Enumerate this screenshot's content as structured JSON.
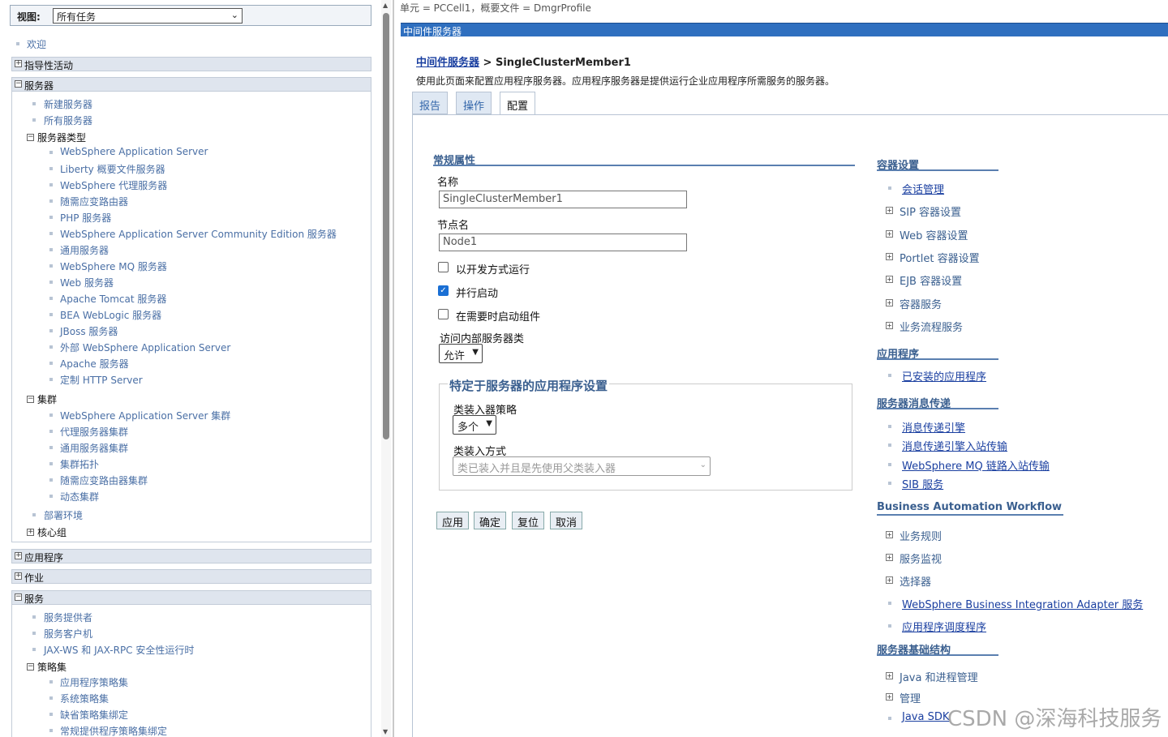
{
  "nav": {
    "view_label": "视图:",
    "view_value": "所有任务",
    "welcome": "欢迎",
    "sections": {
      "guided": "指导性活动",
      "servers": "服务器",
      "applications": "应用程序",
      "jobs": "作业",
      "services": "服务"
    },
    "servers_items": {
      "new_server": "新建服务器",
      "all_servers": "所有服务器",
      "server_types": "服务器类型",
      "types": [
        "WebSphere Application Server",
        "Liberty 概要文件服务器",
        "WebSphere 代理服务器",
        "随需应变路由器",
        "PHP 服务器",
        "WebSphere Application Server Community Edition 服务器",
        "通用服务器",
        "WebSphere MQ 服务器",
        "Web 服务器",
        "Apache Tomcat 服务器",
        "BEA WebLogic 服务器",
        "JBoss 服务器",
        "外部 WebSphere Application Server",
        "Apache 服务器",
        "定制 HTTP Server"
      ],
      "clusters": "集群",
      "cluster_items": [
        "WebSphere Application Server 集群",
        "代理服务器集群",
        "通用服务器集群",
        "集群拓扑",
        "随需应变路由器集群",
        "动态集群"
      ],
      "deployment_env": "部署环境",
      "core_groups": "核心组"
    },
    "services_items": {
      "items": [
        "服务提供者",
        "服务客户机",
        "JAX-WS 和 JAX-RPC 安全性运行时"
      ],
      "policy_sets": "策略集",
      "policy_items": [
        "应用程序策略集",
        "系统策略集",
        "缺省策略集绑定",
        "常规提供程序策略集绑定"
      ]
    }
  },
  "header": {
    "context": "单元 = PCCell1，概要文件 = DmgrProfile",
    "title": "中间件服务器"
  },
  "page": {
    "crumb_link": "中间件服务器",
    "crumb_sep": " > ",
    "crumb_current": "SingleClusterMember1",
    "description": "使用此页面来配置应用程序服务器。应用程序服务器是提供运行企业应用程序所需服务的服务器。",
    "tabs": [
      "报告",
      "操作",
      "配置"
    ]
  },
  "form": {
    "general_heading": "常规属性",
    "name_label": "名称",
    "name_value": "SingleClusterMember1",
    "node_label": "节点名",
    "node_value": "Node1",
    "dev_mode_label": "以开发方式运行",
    "dev_mode_checked": false,
    "parallel_start_label": "并行启动",
    "parallel_start_checked": true,
    "on_demand_label": "在需要时启动组件",
    "on_demand_checked": false,
    "internal_class_label": "访问内部服务器类",
    "internal_class_value": "允许",
    "app_settings_heading": "特定于服务器的应用程序设置",
    "classloader_policy_label": "类装入器策略",
    "classloader_policy_value": "多个",
    "class_loading_mode_label": "类装入方式",
    "class_loading_mode_value": "类已装入并且是先使用父类装入器",
    "buttons": [
      "应用",
      "确定",
      "复位",
      "取消"
    ]
  },
  "right": {
    "container_settings": "容器设置",
    "container_items": [
      {
        "label": "会话管理",
        "link": true
      },
      {
        "label": "SIP 容器设置",
        "link": false
      },
      {
        "label": "Web 容器设置",
        "link": false
      },
      {
        "label": "Portlet 容器设置",
        "link": false
      },
      {
        "label": "EJB 容器设置",
        "link": false
      },
      {
        "label": "容器服务",
        "link": false
      },
      {
        "label": "业务流程服务",
        "link": false
      }
    ],
    "applications": "应用程序",
    "app_items": [
      "已安装的应用程序"
    ],
    "messaging": "服务器消息传递",
    "messaging_items": [
      "消息传递引擎",
      "消息传递引擎入站传输",
      "WebSphere MQ 链路入站传输",
      "SIB 服务"
    ],
    "baw": "Business Automation Workflow",
    "baw_items": [
      {
        "label": "业务规则",
        "link": false
      },
      {
        "label": "服务监视",
        "link": false
      },
      {
        "label": "选择器",
        "link": false
      },
      {
        "label": "WebSphere Business Integration Adapter 服务",
        "link": true
      },
      {
        "label": "应用程序调度程序",
        "link": true
      }
    ],
    "infrastructure": "服务器基础结构",
    "infra_items": [
      {
        "label": "Java 和进程管理",
        "link": false
      },
      {
        "label": "管理",
        "link": false
      },
      {
        "label": "Java SDK",
        "link": true
      }
    ]
  },
  "watermark": "CSDN @深海科技服务",
  "colors": {
    "accent": "#2f6fbf",
    "link": "#1a3fa0",
    "nav_text": "#4a6fa5"
  }
}
